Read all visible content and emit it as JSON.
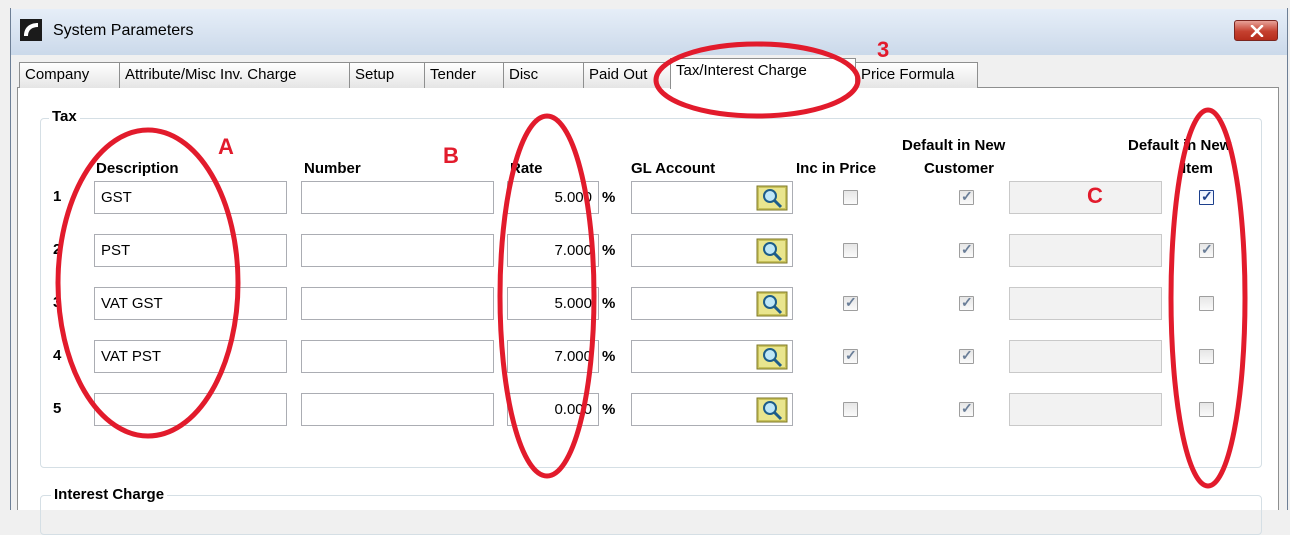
{
  "window": {
    "title": "System Parameters"
  },
  "tabs": [
    {
      "label": "Company"
    },
    {
      "label": "Attribute/Misc Inv. Charge"
    },
    {
      "label": "Setup"
    },
    {
      "label": "Tender"
    },
    {
      "label": "Disc"
    },
    {
      "label": "Paid Out"
    },
    {
      "label": "Tax/Interest Charge",
      "active": true
    },
    {
      "label": "Price Formula"
    }
  ],
  "tax": {
    "legend": "Tax",
    "headers": {
      "description": "Description",
      "number": "Number",
      "rate": "Rate",
      "gl_account": "GL Account",
      "inc_in_price": "Inc in Price",
      "default_customer_line1": "Default in New",
      "default_customer_line2": "Customer",
      "default_item_line1": "Default in New",
      "default_item_line2": "Item"
    },
    "rows": [
      {
        "num": "1",
        "description": "GST",
        "number": "",
        "rate": "5.000",
        "pct": "%",
        "gl_account": "",
        "inc_in_price": false,
        "default_customer": true,
        "default_item": true
      },
      {
        "num": "2",
        "description": "PST",
        "number": "",
        "rate": "7.000",
        "pct": "%",
        "gl_account": "",
        "inc_in_price": false,
        "default_customer": true,
        "default_item": true
      },
      {
        "num": "3",
        "description": "VAT GST",
        "number": "",
        "rate": "5.000",
        "pct": "%",
        "gl_account": "",
        "inc_in_price": true,
        "default_customer": true,
        "default_item": false
      },
      {
        "num": "4",
        "description": "VAT PST",
        "number": "",
        "rate": "7.000",
        "pct": "%",
        "gl_account": "",
        "inc_in_price": true,
        "default_customer": true,
        "default_item": false
      },
      {
        "num": "5",
        "description": "",
        "number": "",
        "rate": "0.000",
        "pct": "%",
        "gl_account": "",
        "inc_in_price": false,
        "default_customer": true,
        "default_item": false
      }
    ]
  },
  "interest": {
    "legend": "Interest Charge"
  },
  "annotations": {
    "a": "A",
    "b": "B",
    "c": "C",
    "three": "3"
  },
  "colors": {
    "annotation": "#e21b2c",
    "checkbox_check": "#1c3f8c"
  }
}
